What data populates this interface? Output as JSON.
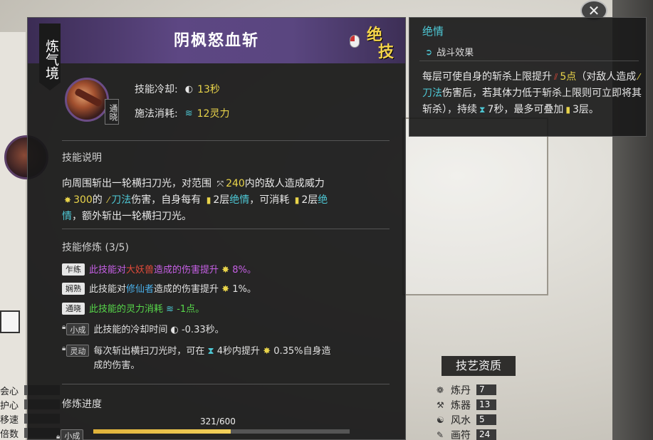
{
  "skill": {
    "name": "阴枫怒血斩",
    "realm_tag": "炼气境",
    "type_tag_top": "绝",
    "type_tag_bottom": "技",
    "icon": "blade-slash-icon",
    "mastery_badge": "通晓",
    "cooldown_label": "技能冷却:",
    "cooldown_value": "13秒",
    "cost_label": "施法消耗:",
    "cost_value": "12灵力"
  },
  "description": {
    "heading": "技能说明",
    "line1_a": "向周围斩出一轮横扫刀光，对范围",
    "line1_range": "240",
    "line1_b": "内的敌人造成威力",
    "line2_power": "300",
    "line2_a": "的",
    "line2_dao": "刀法",
    "line2_b": "伤害，自身每有",
    "line2_layers": "2层",
    "line2_jueqing": "绝情",
    "line2_c": "，可消耗",
    "line2_layers2": "2层",
    "line2_jueqing2": "绝",
    "line3_jueqing_end": "情",
    "line3_a": "，额外斩出一轮横扫刀光。"
  },
  "cultivation": {
    "heading": "技能修炼 (3/5)",
    "mods": [
      {
        "badge": "乍练",
        "text_a": "此技能对",
        "target": "大妖兽",
        "text_b": "造成的伤害提升",
        "value": "8%。"
      },
      {
        "badge": "娴熟",
        "text_a": "此技能对",
        "target": "修仙者",
        "text_b": "造成的伤害提升",
        "value": "1%。"
      },
      {
        "badge": "通晓",
        "text": "此技能的灵力消耗",
        "value": "-1点。"
      },
      {
        "badge": "小成",
        "text": "此技能的冷却时间",
        "value": "-0.33秒。"
      },
      {
        "badge": "灵动",
        "text_a": "每次斩出横扫刀光时，可在",
        "duration": "4秒内提升",
        "value": "0.35%自身造",
        "text_b": "成的伤害。"
      }
    ],
    "progress_heading": "修炼进度",
    "progress_text": "321/600",
    "progress_fraction": 0.535,
    "progress_badge": "小成"
  },
  "side_tip": {
    "title": "绝情",
    "subtitle": "战斗效果",
    "body_a": "每层可使自身的斩杀上限提升",
    "body_val": "5点",
    "body_b": "（对敌人造成",
    "body_dao": "刀法",
    "body_c": "伤害后，若其体力低于斩杀上限则可立即将其斩杀），持续",
    "body_dur": "7秒",
    "body_d": "，最多可叠加",
    "body_layers": "3层",
    "body_e": "。"
  },
  "background": {
    "skills_title": "技艺资质",
    "skills": [
      {
        "label": "炼丹",
        "value": "7",
        "icon": "pill-icon"
      },
      {
        "label": "炼器",
        "value": "13",
        "icon": "hammer-icon"
      },
      {
        "label": "风水",
        "value": "5",
        "icon": "compass-icon"
      },
      {
        "label": "画符",
        "value": "24",
        "icon": "talisman-icon"
      }
    ],
    "stats": [
      {
        "label": "会心"
      },
      {
        "label": "护心"
      },
      {
        "label": "移速"
      },
      {
        "label": "倍数"
      }
    ]
  }
}
